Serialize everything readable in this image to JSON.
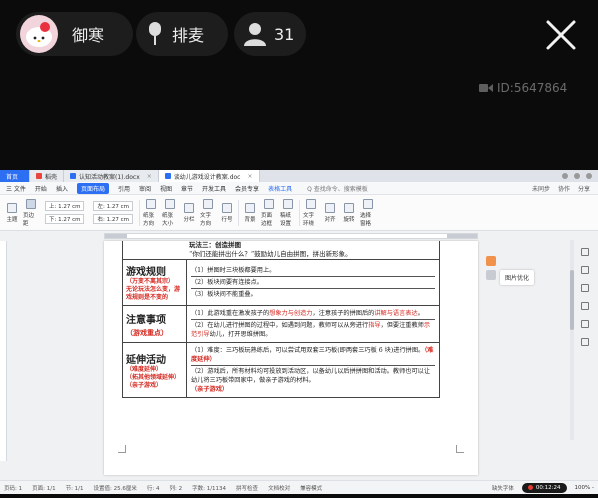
{
  "stream": {
    "host_name": "御寒",
    "mic_label": "排麦",
    "viewer_count": "31",
    "room_id": "ID:5647864"
  },
  "wps": {
    "tabs": [
      {
        "label": "首页"
      },
      {
        "label": "稻壳"
      },
      {
        "label": "认知活动教案(1).docx"
      },
      {
        "label": "谈幼儿游戏设计教案.doc"
      }
    ],
    "menu": [
      "三 文件",
      "开始",
      "插入",
      "页面布局",
      "引用",
      "审阅",
      "视图",
      "章节",
      "开发工具",
      "会员专享",
      "表格工具"
    ],
    "menu_selected": "页面布局",
    "menu_tools": "表格工具",
    "search_hint": "Q 查找命令、搜索模板",
    "menu_right": [
      "未同步",
      "协作",
      "分享"
    ],
    "ribbon": {
      "items_left": [
        "主题",
        "页边距"
      ],
      "margin_top": "上: 1.27 cm",
      "margin_bottom": "下: 1.27 cm",
      "margin_left": "左: 1.27 cm",
      "margin_right": "右: 1.27 cm",
      "items_right": [
        "纸张方向",
        "纸张大小",
        "分栏",
        "文字方向",
        "行号",
        "背景",
        "页面边框",
        "稿纸设置",
        "文字环绕",
        "对齐",
        "旋转",
        "选择窗格"
      ]
    },
    "document": {
      "pre_line1": "玩法三：创造拼图",
      "pre_line2": "“你们还能拼出什么？”鼓励幼儿自由拼图，拼出新形象。",
      "rows": [
        {
          "heading": "游戏规则",
          "notes": [
            "（万变不离其宗）",
            "无论玩法怎么变，游",
            "戏规则是不变的"
          ],
          "lines": [
            "（1）拼图时三块板都要用上。",
            "（2）板块间要有连接点。",
            "（3）板块间不能重叠。"
          ]
        },
        {
          "heading": "注意事项",
          "notes": [
            "（游戏重点）"
          ],
          "lines": [
            [
              "（1）此游戏重在激发孩子的",
              "想象力与创造力",
              "，注意孩子的拼图后的",
              "讲解与语言表达",
              "。"
            ],
            [
              "（2）在幼儿进行拼图的过程中，如遇到问题，教师可以从旁进行",
              "指导",
              "，但要注重教师",
              "示范引导",
              "幼儿，打开思维拼图。"
            ]
          ]
        },
        {
          "heading": "延伸活动",
          "notes": [
            "（难度延伸）",
            "（拓其他领域延伸）",
            "（亲子游戏）"
          ],
          "lines": [
            [
              "（1）难度：三巧板玩熟练后，可以尝试用双套三巧板(即两套三巧板 6 块)进行拼图。",
              "（难度延伸）"
            ],
            [
              "（2）游戏后，所有材料均可投放到活动区，以备幼儿以后拼拼图和活动。教师也可以让幼儿将三巧板带回家中，做亲子游戏的材料。",
              "（亲子游戏）"
            ]
          ]
        }
      ]
    },
    "side_tip": "图片优化",
    "status": {
      "left": [
        "页码: 1",
        "页面: 1/1",
        "节: 1/1",
        "设置值: 25.6厘米",
        "行: 4",
        "列: 2",
        "字数: 1/1134",
        "拼写检查",
        "文档校对",
        "兼容模式"
      ],
      "right_label": "缺失字体",
      "rec_time": "00:12:24",
      "zoom": "100% -"
    }
  }
}
